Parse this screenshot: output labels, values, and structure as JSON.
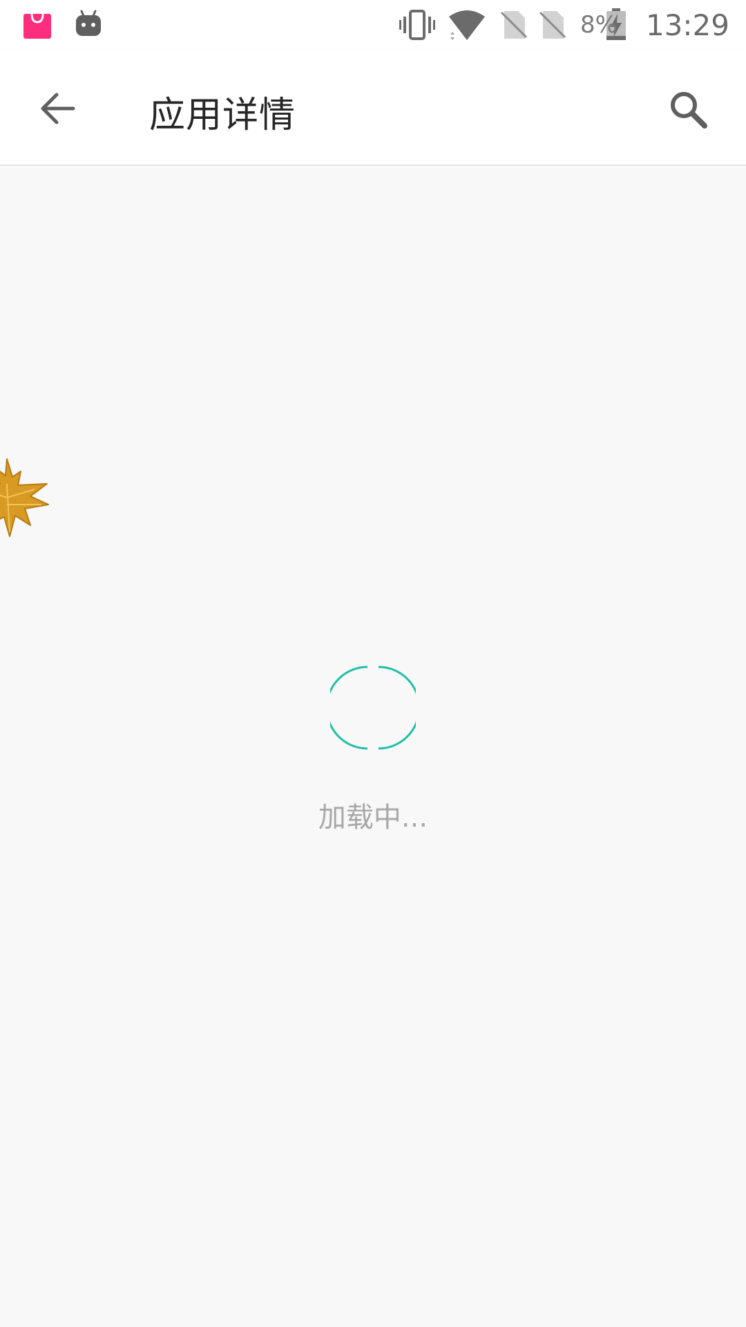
{
  "status_bar": {
    "battery_percent": "8%",
    "time": "13:29",
    "left_icons": [
      "shopping-bag-icon",
      "android-icon"
    ],
    "right_icons": [
      "vibrate-icon",
      "wifi-icon",
      "no-sim-icon",
      "no-sim-icon",
      "battery-charging-icon"
    ]
  },
  "app_bar": {
    "title": "应用详情",
    "back_icon": "arrow-back-icon",
    "search_icon": "search-icon"
  },
  "content": {
    "loading_text": "加载中...",
    "spinner_color": "#1fbfa6"
  },
  "colors": {
    "accent": "#1fbfa6",
    "shopping_bag": "#ff2d7e",
    "icon_gray": "#6b6b6b",
    "background": "#f8f8f8"
  }
}
